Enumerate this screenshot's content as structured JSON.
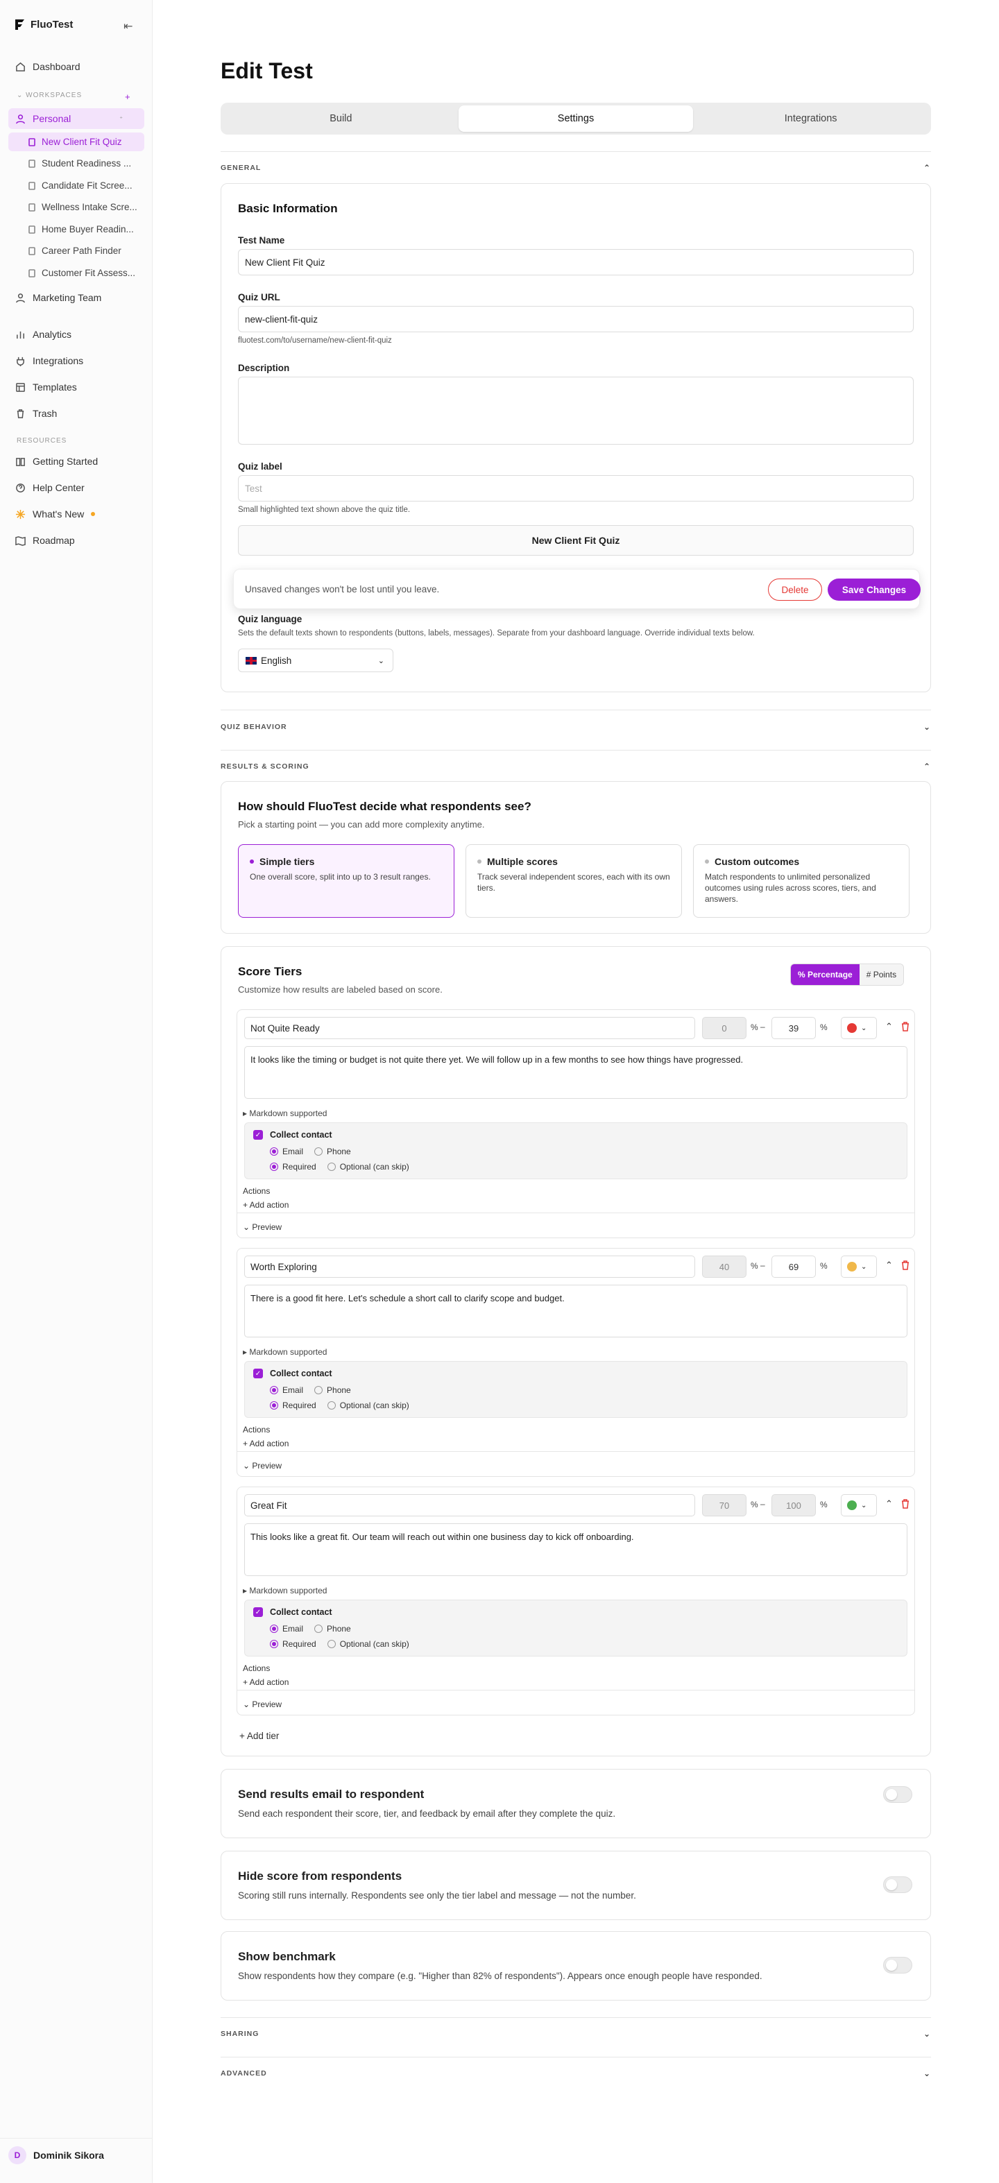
{
  "app": {
    "name": "FluoTest",
    "collapse_icon": "collapse-sidebar-icon"
  },
  "sidebar": {
    "dashboard": "Dashboard",
    "workspaces_label": "WORKSPACES",
    "personal": "Personal",
    "quizzes": [
      "New Client Fit Quiz",
      "Student Readiness ...",
      "Candidate Fit Scree...",
      "Wellness Intake Scre...",
      "Home Buyer Readin...",
      "Career Path Finder",
      "Customer Fit Assess..."
    ],
    "marketing_team": "Marketing Team",
    "analytics": "Analytics",
    "integrations": "Integrations",
    "templates": "Templates",
    "trash": "Trash",
    "resources_label": "RESOURCES",
    "getting_started": "Getting Started",
    "help_center": "Help Center",
    "whats_new": "What's New",
    "roadmap": "Roadmap",
    "user_initial": "D",
    "user_name": "Dominik Sikora"
  },
  "page": {
    "title": "Edit Test",
    "tabs": [
      "Build",
      "Settings",
      "Integrations"
    ],
    "active_tab": "Settings"
  },
  "general": {
    "section": "GENERAL",
    "card_title": "Basic Information",
    "test_name_label": "Test Name",
    "test_name_value": "New Client Fit Quiz",
    "quiz_url_label": "Quiz URL",
    "quiz_url_value": "new-client-fit-quiz",
    "quiz_url_hint": "fluotest.com/to/username/new-client-fit-quiz",
    "description_label": "Description",
    "description_value": "",
    "quiz_label_label": "Quiz label",
    "quiz_label_placeholder": "Test",
    "quiz_label_hint": "Small highlighted text shown above the quiz title.",
    "preview_title": "New Client Fit Quiz",
    "quiz_language_label": "Quiz language",
    "quiz_language_hint": "Sets the default texts shown to respondents (buttons, labels, messages). Separate from your dashboard language. Override individual texts below.",
    "language_value": "English"
  },
  "toast": {
    "message": "Unsaved changes won't be lost until you leave.",
    "delete_label": "Delete",
    "save_label": "Save Changes"
  },
  "quiz_behavior": {
    "section": "QUIZ BEHAVIOR"
  },
  "results": {
    "section": "RESULTS & SCORING",
    "question": "How should FluoTest decide what respondents see?",
    "subtitle": "Pick a starting point — you can add more complexity anytime.",
    "options": [
      {
        "title": "Simple tiers",
        "desc": "One overall score, split into up to 3 result ranges."
      },
      {
        "title": "Multiple scores",
        "desc": "Track several independent scores, each with its own tiers."
      },
      {
        "title": "Custom outcomes",
        "desc": "Match respondents to unlimited personalized outcomes using rules across scores, tiers, and answers."
      }
    ],
    "selected_option": "Simple tiers"
  },
  "tiers": {
    "title": "Score Tiers",
    "subtitle": "Customize how results are labeled based on score.",
    "mode_percentage": "% Percentage",
    "mode_points": "# Points",
    "pct_symbol": "%",
    "range_dash": "–",
    "markdown_label": "▸ Markdown supported",
    "collect_contact": "Collect contact",
    "email": "Email",
    "phone": "Phone",
    "required": "Required",
    "optional": "Optional (can skip)",
    "actions_label": "Actions",
    "add_action": "+ Add action",
    "preview": "⌄ Preview",
    "add_tier": "+ Add tier",
    "items": [
      {
        "name": "Not Quite Ready",
        "min": "0",
        "max": "39",
        "color": "#e53935",
        "message": "It looks like the timing or budget is not quite there yet. We will follow up in a few months to see how things have progressed."
      },
      {
        "name": "Worth Exploring",
        "min": "40",
        "max": "69",
        "color": "#f0b84a",
        "message": "There is a good fit here. Let's schedule a short call to clarify scope and budget."
      },
      {
        "name": "Great Fit",
        "min": "70",
        "max": "100",
        "color": "#4caf50",
        "message": "This looks like a great fit. Our team will reach out within one business day to kick off onboarding."
      }
    ]
  },
  "toggles": [
    {
      "title": "Send results email to respondent",
      "desc": "Send each respondent their score, tier, and feedback by email after they complete the quiz.",
      "on": false
    },
    {
      "title": "Hide score from respondents",
      "desc": "Scoring still runs internally. Respondents see only the tier label and message — not the number.",
      "on": false
    },
    {
      "title": "Show benchmark",
      "desc": "Show respondents how they compare (e.g. \"Higher than 82% of respondents\"). Appears once enough people have responded.",
      "on": false
    }
  ],
  "sharing": {
    "section": "SHARING"
  },
  "advanced": {
    "section": "ADVANCED"
  },
  "colors": {
    "accent": "#9b1fd6",
    "danger": "#e53935"
  }
}
